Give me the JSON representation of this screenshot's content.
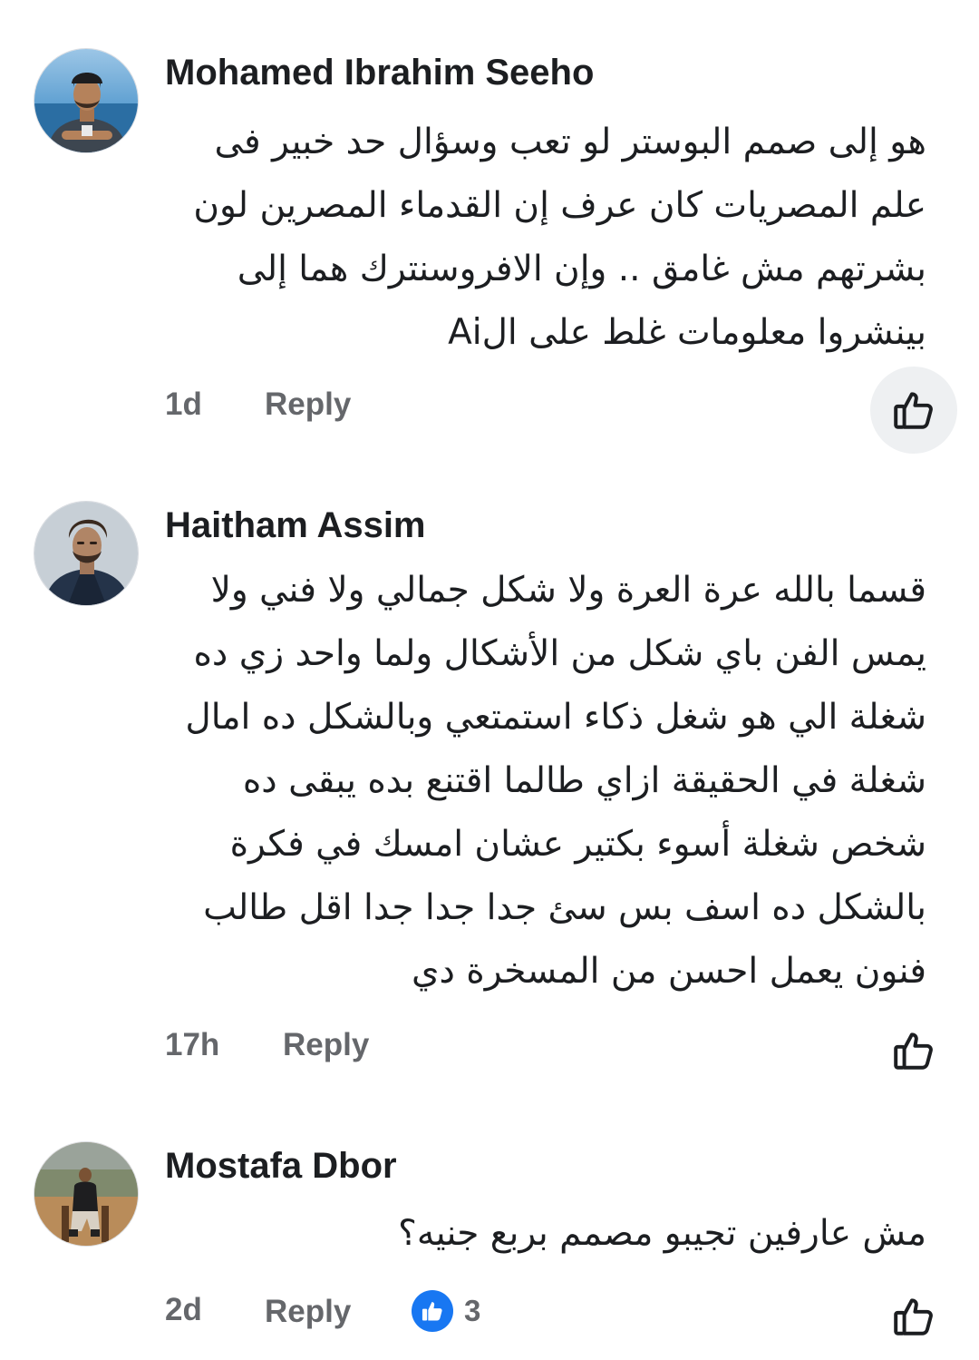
{
  "comments": [
    {
      "author": "Mohamed Ibrahim Seeho",
      "text": "هو إلى صمم البوستر لو تعب وسؤال حد خبير فى\nعلم المصريات كان عرف إن القدماء المصرين  لون\nبشرتهم مش غامق .. وإن الافروسنترك  هما إلى\nبينشروا معلومات غلط على الAi",
      "time": "1d",
      "reply_label": "Reply"
    },
    {
      "author": "Haitham Assim",
      "text": "قسما بالله عرة العرة ولا شكل جمالي ولا فني ولا\nيمس الفن باي شكل من الأشكال  ولما واحد زي ده\nشغلة  الي هو شغل ذكاء استمتعي وبالشكل ده امال\nشغلة في الحقيقة ازاي طالما اقتنع بده يبقى ده\nشخص  شغلة أسوء بكتير عشان امسك في فكرة\nبالشكل ده اسف بس سئ جدا جدا جدا  اقل طالب\nفنون يعمل احسن من المسخرة دي",
      "time": "17h",
      "reply_label": "Reply"
    },
    {
      "author": "Mostafa Dbor",
      "text": "مش عارفين تجيبو مصمم بربع جنيه؟",
      "time": "2d",
      "reply_label": "Reply",
      "reaction_count": "3"
    }
  ],
  "icons": {
    "like": "thumbs-up-outline-icon",
    "reaction": "like-reaction-icon"
  },
  "colors": {
    "meta_text": "#65676b",
    "like_blue": "#1877f2",
    "pressed_bg": "#eef0f2"
  }
}
